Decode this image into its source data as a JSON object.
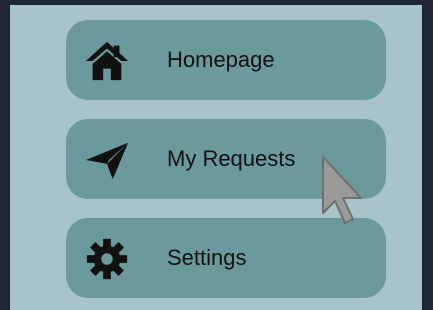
{
  "nav": {
    "items": [
      {
        "label": "Homepage",
        "icon": "home-icon"
      },
      {
        "label": "My Requests",
        "icon": "paper-plane-icon"
      },
      {
        "label": "Settings",
        "icon": "gear-icon"
      }
    ]
  },
  "colors": {
    "outer_frame": "#1f2636",
    "sidebar_background": "#a8c4c8",
    "nav_item_background": "#6b999c",
    "text": "#111111",
    "icon": "#111111",
    "cursor_fill": "#9a9a9a"
  }
}
